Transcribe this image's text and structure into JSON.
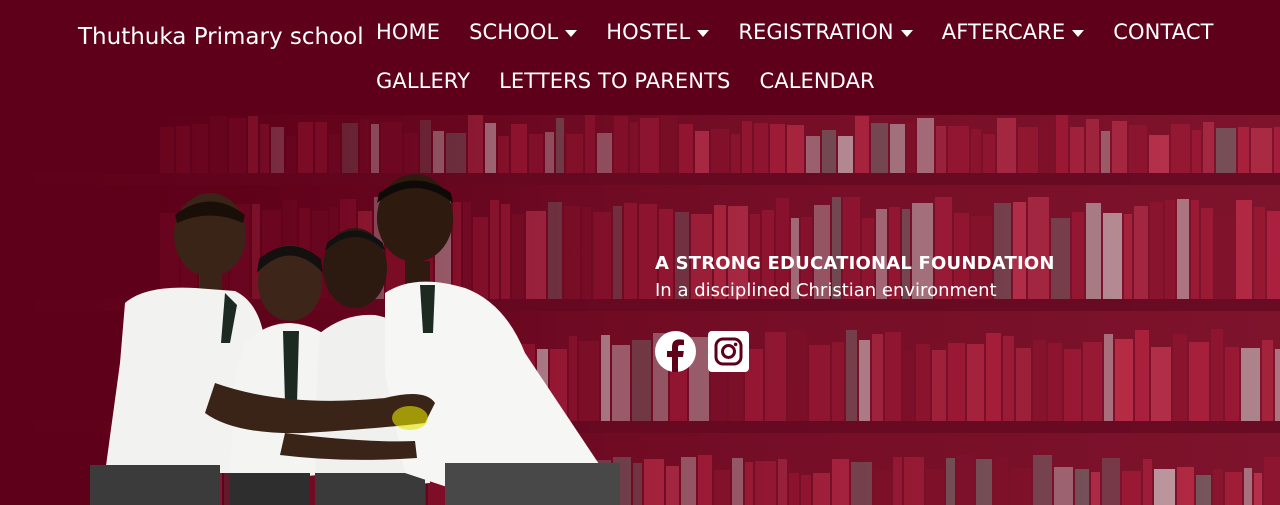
{
  "brand": "Thuthuka Primary school",
  "nav": {
    "row1": [
      {
        "label": "HOME",
        "dropdown": false
      },
      {
        "label": "SCHOOL",
        "dropdown": true
      },
      {
        "label": "HOSTEL",
        "dropdown": true
      },
      {
        "label": "REGISTRATION",
        "dropdown": true
      },
      {
        "label": "AFTERCARE",
        "dropdown": true
      },
      {
        "label": "CONTACT",
        "dropdown": false
      }
    ],
    "row2": [
      {
        "label": "GALLERY",
        "dropdown": false
      },
      {
        "label": "LETTERS TO PARENTS",
        "dropdown": false
      },
      {
        "label": "CALENDAR",
        "dropdown": false
      }
    ]
  },
  "hero": {
    "title": "A STRONG EDUCATIONAL FOUNDATION",
    "subtitle": "In a disciplined Christian environment",
    "socials": [
      "facebook-icon",
      "instagram-icon"
    ]
  },
  "colors": {
    "brand_maroon": "#5e0019",
    "text": "#ffffff"
  }
}
